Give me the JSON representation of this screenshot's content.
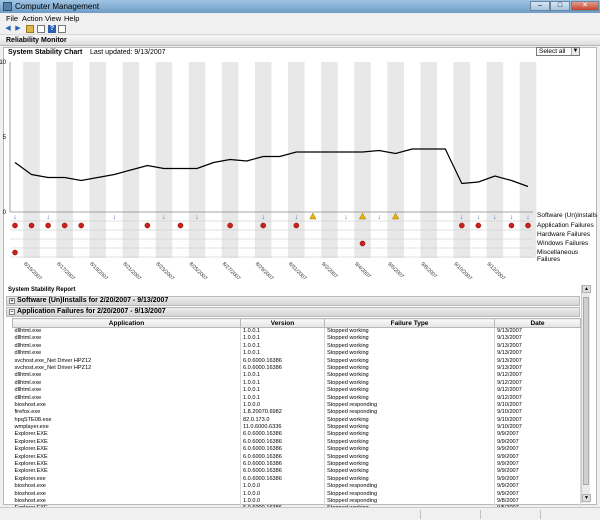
{
  "window": {
    "title": "Computer Management",
    "minimize": "–",
    "maximize": "□",
    "close": "✕"
  },
  "menu": [
    "File",
    "Action",
    "View",
    "Help"
  ],
  "page_header": "Reliability Monitor",
  "chart": {
    "title": "System Stability Chart",
    "last_updated": "Last updated: 9/13/2007",
    "select_value": "Select all",
    "y_ticks": [
      "10",
      "5",
      "0"
    ],
    "categories": [
      "Software (Un)Installs",
      "Application Failures",
      "Hardware Failures",
      "Windows Failures",
      "Miscellaneous Failures"
    ],
    "date_labels": [
      "8/15/2007",
      "8/17/2007",
      "8/19/2007",
      "8/21/2007",
      "8/23/2007",
      "8/25/2007",
      "8/27/2007",
      "8/29/2007",
      "8/31/2007",
      "9/2/2007",
      "9/4/2007",
      "9/6/2007",
      "9/8/2007",
      "9/10/2007",
      "9/12/2007"
    ]
  },
  "chart_data": {
    "type": "line",
    "title": "System Stability Chart",
    "ylim": [
      0,
      10
    ],
    "x_start": "8/14/2007",
    "values": [
      3.3,
      2.5,
      2.3,
      2.3,
      2.1,
      2.3,
      2.5,
      2.8,
      3.1,
      2.9,
      2.9,
      2.9,
      3.3,
      3.5,
      3.4,
      3.7,
      3.7,
      4.0,
      4.0,
      4.0,
      4.0,
      4.0,
      4.1,
      3.9,
      4.2,
      4.2,
      4.2,
      1.9,
      2.0,
      2.4,
      2.1,
      1.7
    ],
    "events": {
      "installs": [
        0,
        2,
        6,
        9,
        11,
        15,
        17,
        20,
        22,
        27,
        28,
        29,
        30,
        31
      ],
      "warnings": [
        18,
        21,
        23
      ],
      "app_failures": [
        0,
        1,
        2,
        3,
        4,
        8,
        10,
        13,
        15,
        17,
        27,
        28,
        30,
        31
      ],
      "windows_failures": [
        21
      ],
      "misc_failures": [
        0
      ]
    }
  },
  "report": {
    "title": "System Stability Report",
    "sections": [
      "Software (Un)Installs for 2/20/2007 - 9/13/2007",
      "Application Failures for 2/20/2007 - 9/13/2007"
    ],
    "expand_closed": "+",
    "expand_open": "–",
    "columns": [
      "Application",
      "Version",
      "Failure Type",
      "Date"
    ],
    "rows": [
      [
        "dllhtml.exe",
        "1.0.0.1",
        "Stopped working",
        "9/13/2007"
      ],
      [
        "dllhtml.exe",
        "1.0.0.1",
        "Stopped working",
        "9/13/2007"
      ],
      [
        "dllhtml.exe",
        "1.0.0.1",
        "Stopped working",
        "9/13/2007"
      ],
      [
        "dllhtml.exe",
        "1.0.0.1",
        "Stopped working",
        "9/13/2007"
      ],
      [
        "svchost.exe_Net Driver HPZ12",
        "6.0.6000.16386",
        "Stopped working",
        "9/13/2007"
      ],
      [
        "svchost.exe_Net Driver HPZ12",
        "6.0.6000.16386",
        "Stopped working",
        "9/13/2007"
      ],
      [
        "dllhtml.exe",
        "1.0.0.1",
        "Stopped working",
        "9/12/2007"
      ],
      [
        "dllhtml.exe",
        "1.0.0.1",
        "Stopped working",
        "9/12/2007"
      ],
      [
        "dllhtml.exe",
        "1.0.0.1",
        "Stopped working",
        "9/12/2007"
      ],
      [
        "dllhtml.exe",
        "1.0.0.1",
        "Stopped working",
        "9/12/2007"
      ],
      [
        "bioshost.exe",
        "1.0.0.0",
        "Stopped responding",
        "9/10/2007"
      ],
      [
        "firefox.exe",
        "1.8.20070.6982",
        "Stopped responding",
        "9/10/2007"
      ],
      [
        "hpqSTE08.exe",
        "82.0.173.0",
        "Stopped working",
        "9/10/2007"
      ],
      [
        "wmplayer.exe",
        "11.0.6000.6336",
        "Stopped working",
        "9/10/2007"
      ],
      [
        "Explorer.EXE",
        "6.0.6000.16386",
        "Stopped working",
        "9/9/2007"
      ],
      [
        "Explorer.EXE",
        "6.0.6000.16386",
        "Stopped working",
        "9/9/2007"
      ],
      [
        "Explorer.EXE",
        "6.0.6000.16386",
        "Stopped working",
        "9/9/2007"
      ],
      [
        "Explorer.EXE",
        "6.0.6000.16386",
        "Stopped working",
        "9/9/2007"
      ],
      [
        "Explorer.EXE",
        "6.0.6000.16386",
        "Stopped working",
        "9/9/2007"
      ],
      [
        "Explorer.EXE",
        "6.0.6000.16386",
        "Stopped working",
        "9/9/2007"
      ],
      [
        "Explorer.exe",
        "6.0.6000.16386",
        "Stopped working",
        "9/9/2007"
      ],
      [
        "bioshost.exe",
        "1.0.0.0",
        "Stopped responding",
        "9/9/2007"
      ],
      [
        "bioshost.exe",
        "1.0.0.0",
        "Stopped responding",
        "9/9/2007"
      ],
      [
        "bioshost.exe",
        "1.0.0.0",
        "Stopped responding",
        "9/8/2007"
      ],
      [
        "Explorer.EXE",
        "6.0.6000.16386",
        "Stopped working",
        "9/5/2007"
      ]
    ]
  },
  "colors": {
    "line": "#000000",
    "band": "#e8e8e8",
    "install": "#3d6fb5",
    "warning": "#e8b400",
    "error": "#c8201a"
  }
}
